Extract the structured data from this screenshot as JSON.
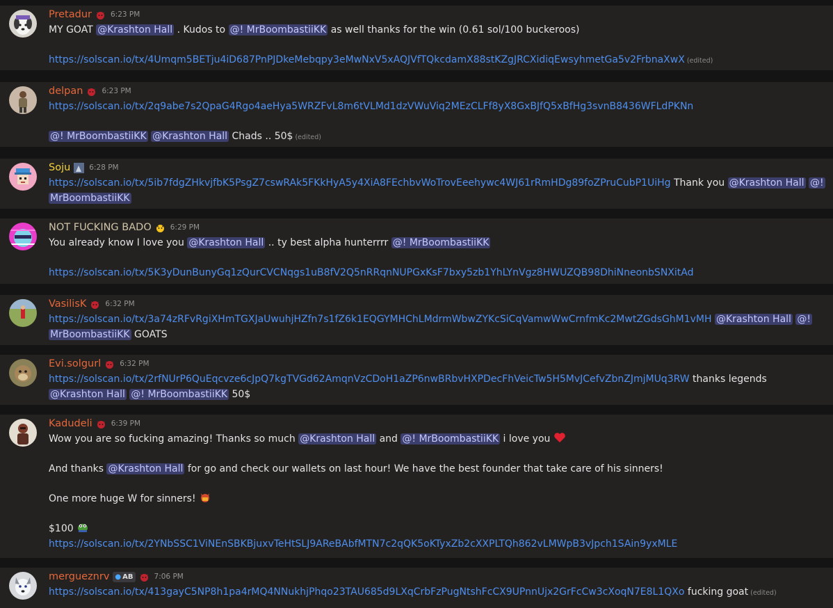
{
  "messages": [
    {
      "username": "Pretadur",
      "name_color": "#e5673a",
      "timestamp": "6:23 PM",
      "avatar": "dog-avatar",
      "l1_a": "MY GOAT ",
      "l1_m1": "@Krashton Hall",
      "l1_b": " . Kudos to ",
      "l1_m2": "@! MrBoombastiiKK",
      "l1_c": " as well thanks for the win (0.61 sol/100 buckeroos)",
      "link": "https://solscan.io/tx/4Umqm5BETju4iD687PnPJDkeMebqpy3eMwNxV5xAQJVfTQkcdamX88stKZgJRCXidiqEwsyhmetGa5v2FrbnaXwX",
      "edited": "(edited)"
    },
    {
      "username": "delpan",
      "name_color": "#e5673a",
      "timestamp": "6:23 PM",
      "avatar": "person-avatar",
      "link": "https://solscan.io/tx/2q9abe7s2QpaG4Rgo4aeHya5WRZFvL8m6tVLMd1dzVWuViq2MEzCLFf8yX8GxBJfQ5xBfHg3svnB8436WFLdPKNn",
      "l2_m1": "@! MrBoombastiiKK",
      "l2_m2": "@Krashton Hall",
      "l2_a": " Chads .. 50$",
      "edited": "(edited)"
    },
    {
      "username": "Soju",
      "name_color": "#f5d33c",
      "timestamp": "6:28 PM",
      "avatar": "pixel-avatar",
      "link": "https://solscan.io/tx/5ib7fdgZHkvjfbK5PsgZ7cswRAk5FKkHyA5y4XiA8FEchbvWoTrovEeehywc4WJ61rRmHDg89foZPruCubP1UiHg",
      "l1_a": " Thank you ",
      "l1_m1": "@Krashton Hall",
      "l1_m2a": "@!",
      "l2_m2b": "MrBoombastiiKK"
    },
    {
      "username": "NOT FUCKING BADO",
      "name_color": "#cfc4a8",
      "timestamp": "6:29 PM",
      "avatar": "glitch-avatar",
      "l1_a": "You already know I love you ",
      "l1_m1": "@Krashton Hall",
      "l1_b": " .. ty best alpha hunterrrr ",
      "l1_m2": "@! MrBoombastiiKK",
      "link": "https://solscan.io/tx/5K3yDunBunyGq1zQurCVCNqgs1uB8fV2Q5nRRqnNUPGxKsF7bxy5zb1YhLYnVgz8HWUZQB98DhiNneonbSNXitAd"
    },
    {
      "username": "VasilisK",
      "name_color": "#e5673a",
      "timestamp": "6:32 PM",
      "avatar": "field-avatar",
      "link": "https://solscan.io/tx/3a74zRFvRgiXHmTGXJaUwuhjHZfn7s1fZ6k1EQGYMHChLMdrmWbwZYKcSiCqVamwWwCrnfmKc2MwtZGdsGhM1vMH",
      "l1_m1": "@Krashton Hall",
      "l1_m2a": "@!",
      "l2_m2b": "MrBoombastiiKK",
      "l2_a": " GOATS"
    },
    {
      "username": "Evi.solgurl",
      "name_color": "#e5673a",
      "timestamp": "6:32 PM",
      "avatar": "ape-avatar",
      "link": "https://solscan.io/tx/2rfNUrP6QuEqcvze6cJpQ7kgTVGd62AmqnVzCDoH1aZP6nwBRbvHXPDecFhVeicTw5H5MvJCefvZbnZJmjMUq3RW",
      "l1_a": " thanks legends",
      "l2_m1": "@Krashton Hall",
      "l2_m2": "@! MrBoombastiiKK",
      "l2_a": " 50$"
    },
    {
      "username": "Kadudeli",
      "name_color": "#e5673a",
      "timestamp": "6:39 PM",
      "avatar": "warrior-avatar",
      "l1_a": "Wow you are so fucking amazing! Thanks so much ",
      "l1_m1": "@Krashton Hall",
      "l1_b": " and ",
      "l1_m2": "@! MrBoombastiiKK",
      "l1_c": " i love you ",
      "l2_a": "And thanks ",
      "l2_m1": "@Krashton Hall",
      "l2_b": " for go and check our wallets on last hour! We have the best founder that take care of his sinners!",
      "l3_a": "One more huge W for sinners! ",
      "l4_a": "$100 ",
      "link": "https://solscan.io/tx/2YNbSSC1ViNEnSBKBjuxvTeHtSLJ9AReBAbfMTN7c2qQK5oKTyxZb2cXXPLTQh862vLMWpB3vJpch1SAin9yxMLE"
    },
    {
      "username": "mergueznrv",
      "name_color": "#e5673a",
      "timestamp": "7:06 PM",
      "avatar": "wolf-avatar",
      "role_tag": "AB",
      "link": "https://solscan.io/tx/413gayC5NP8h1pa4rMQ4NNukhjPhqo23TAU685d9LXqCrbFzPugNtshFcCX9UPnnUjx2GrFcCw3cXoqN7E8L1QXo",
      "l1_a": " fucking goat",
      "edited": "(edited)"
    }
  ]
}
